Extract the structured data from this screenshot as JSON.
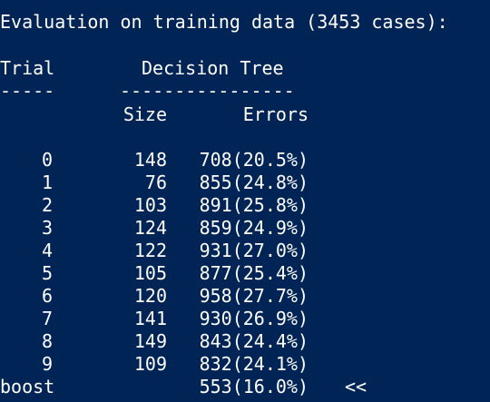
{
  "window": {
    "background": "#012456",
    "foreground": "#FFFFFF"
  },
  "output": {
    "header_line": "Evaluation on training data (3453 cases):",
    "col_trial": "Trial",
    "col_decision_tree": "Decision Tree",
    "trial_underline": "-----",
    "tree_underline": "----------------",
    "col_size": "Size",
    "col_errors": "Errors",
    "rows": [
      {
        "trial": "0",
        "size": "148",
        "errors": "708(20.5%)"
      },
      {
        "trial": "1",
        "size": "76",
        "errors": "855(24.8%)"
      },
      {
        "trial": "2",
        "size": "103",
        "errors": "891(25.8%)"
      },
      {
        "trial": "3",
        "size": "124",
        "errors": "859(24.9%)"
      },
      {
        "trial": "4",
        "size": "122",
        "errors": "931(27.0%)"
      },
      {
        "trial": "5",
        "size": "105",
        "errors": "877(25.4%)"
      },
      {
        "trial": "6",
        "size": "120",
        "errors": "958(27.7%)"
      },
      {
        "trial": "7",
        "size": "141",
        "errors": "930(26.9%)"
      },
      {
        "trial": "8",
        "size": "149",
        "errors": "843(24.4%)"
      },
      {
        "trial": "9",
        "size": "109",
        "errors": "832(24.1%)"
      }
    ],
    "boost": {
      "label": "boost",
      "errors": "553(16.0%)",
      "marker": "<<"
    }
  }
}
